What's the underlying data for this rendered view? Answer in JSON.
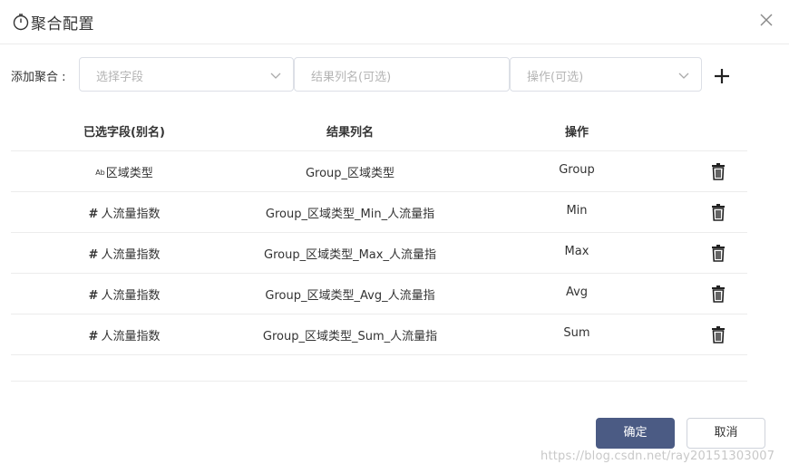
{
  "dialog": {
    "title": "聚合配置",
    "icons": {
      "title": "timer-icon",
      "close": "close-icon",
      "add": "plus-icon",
      "delete": "trash-icon",
      "dropdown": "chevron-down-icon"
    }
  },
  "add_row": {
    "label": "添加聚合 :",
    "field_placeholder": "选择字段",
    "result_name_placeholder": "结果列名(可选)",
    "operation_placeholder": "操作(可选)"
  },
  "table": {
    "headers": [
      "已选字段(别名)",
      "结果列名",
      "操作"
    ],
    "rows": [
      {
        "type_marker": "Ab",
        "field": "区域类型",
        "result_name": "Group_区域类型",
        "operation": "Group"
      },
      {
        "type_marker": "#",
        "field": "人流量指数",
        "result_name": "Group_区域类型_Min_人流量指",
        "operation": "Min"
      },
      {
        "type_marker": "#",
        "field": "人流量指数",
        "result_name": "Group_区域类型_Max_人流量指",
        "operation": "Max"
      },
      {
        "type_marker": "#",
        "field": "人流量指数",
        "result_name": "Group_区域类型_Avg_人流量指",
        "operation": "Avg"
      },
      {
        "type_marker": "#",
        "field": "人流量指数",
        "result_name": "Group_区域类型_Sum_人流量指",
        "operation": "Sum"
      }
    ]
  },
  "footer": {
    "ok_label": "确定",
    "cancel_label": "取消",
    "watermark": "https://blog.csdn.net/ray20151303007"
  },
  "colors": {
    "primary": "#4b5b84",
    "border": "#dcdfe6",
    "placeholder": "#b4b4b4",
    "divider": "#ececec"
  }
}
